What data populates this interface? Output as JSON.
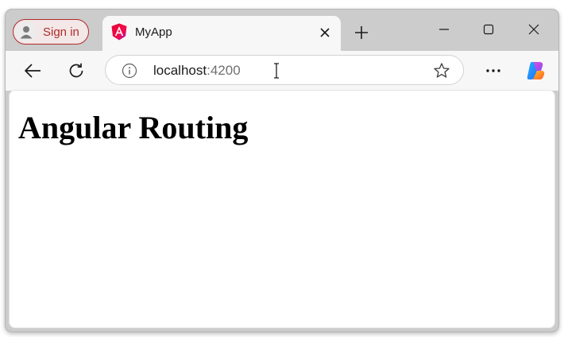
{
  "browser": {
    "signin_label": "Sign in",
    "tab": {
      "title": "MyApp",
      "favicon": "angular-icon"
    },
    "address": {
      "host": "localhost",
      "port": ":4200"
    },
    "window_controls": [
      "minimize-icon",
      "maximize-icon",
      "close-icon"
    ],
    "accent_color": "#b02a2a"
  },
  "page": {
    "heading": "Angular Routing"
  }
}
